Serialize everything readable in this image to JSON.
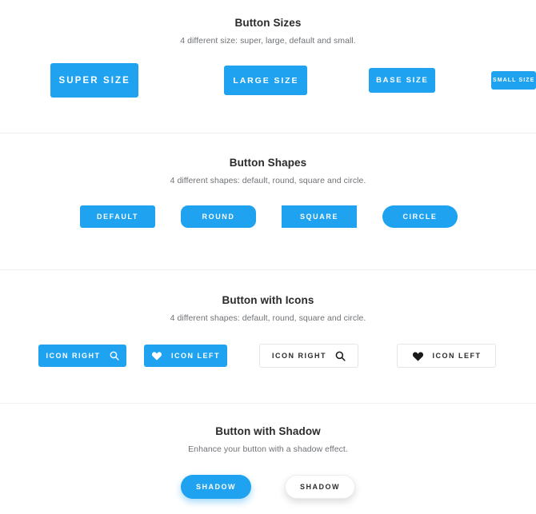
{
  "sections": [
    {
      "title": "Button Sizes",
      "subtitle": "4 different size: super, large, default and small.",
      "buttons": [
        {
          "label": "SUPER SIZE"
        },
        {
          "label": "LARGE SIZE"
        },
        {
          "label": "BASE SIZE"
        },
        {
          "label": "SMALL SIZE"
        }
      ]
    },
    {
      "title": "Button Shapes",
      "subtitle": "4 different shapes: default, round, square and circle.",
      "buttons": [
        {
          "label": "DEFAULT"
        },
        {
          "label": "ROUND"
        },
        {
          "label": "SQUARE"
        },
        {
          "label": "CIRCLE"
        }
      ]
    },
    {
      "title": "Button with Icons",
      "subtitle": "4 different shapes: default, round, square and circle.",
      "buttons": [
        {
          "label": "ICON RIGHT",
          "icon": "search-icon",
          "icon_position": "right",
          "style": "solid"
        },
        {
          "label": "ICON LEFT",
          "icon": "heart-icon",
          "icon_position": "left",
          "style": "solid"
        },
        {
          "label": "ICON RIGHT",
          "icon": "search-icon",
          "icon_position": "right",
          "style": "outline"
        },
        {
          "label": "ICON LEFT",
          "icon": "heart-icon",
          "icon_position": "left",
          "style": "outline"
        }
      ]
    },
    {
      "title": "Button with Shadow",
      "subtitle": "Enhance your button with a shadow effect.",
      "buttons": [
        {
          "label": "SHADOW",
          "style": "solid"
        },
        {
          "label": "SHADOW",
          "style": "light"
        }
      ]
    }
  ],
  "colors": {
    "primary": "#1fa2ef",
    "text_dark": "#2b2b2b",
    "text_muted": "#6f7276",
    "border": "#e3e4e6",
    "divider": "#f1f1f3",
    "background": "#ffffff"
  }
}
